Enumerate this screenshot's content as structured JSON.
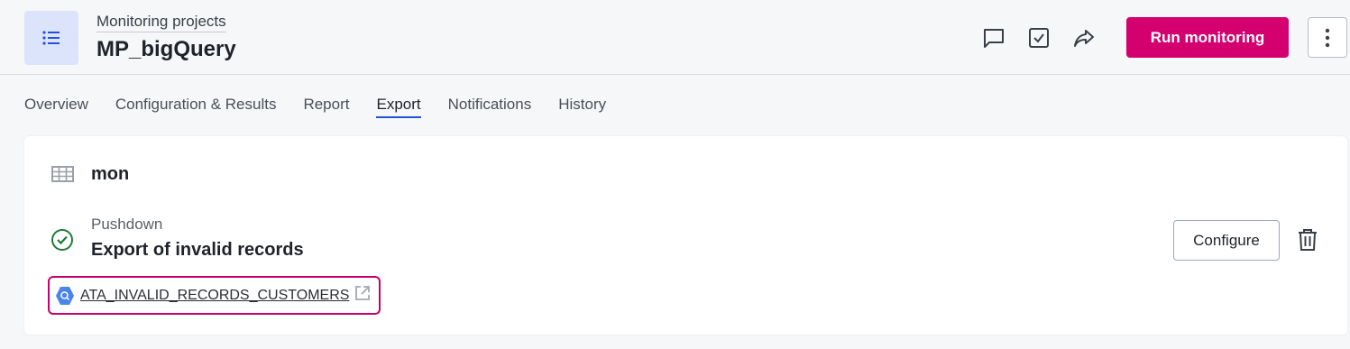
{
  "header": {
    "breadcrumb": "Monitoring projects",
    "title": "MP_bigQuery",
    "icons": [
      "list-icon",
      "comment-icon",
      "checkbox-icon",
      "share-icon",
      "more-vertical-icon"
    ],
    "run_label": "Run monitoring",
    "accent_color": "#d4006f"
  },
  "tabs": [
    {
      "label": "Overview",
      "active": false
    },
    {
      "label": "Configuration & Results",
      "active": false
    },
    {
      "label": "Report",
      "active": false
    },
    {
      "label": "Export",
      "active": true
    },
    {
      "label": "Notifications",
      "active": false
    },
    {
      "label": "History",
      "active": false
    }
  ],
  "card": {
    "icon": "table-icon",
    "title": "mon",
    "export": {
      "status_icon": "check-circle-icon",
      "subtype": "Pushdown",
      "title": "Export of invalid records",
      "link_icon": "bigquery-icon",
      "link_text": "ATA_INVALID_RECORDS_CUSTOMERS",
      "external_icon": "external-link-icon",
      "configure_label": "Configure",
      "delete_icon": "trash-icon"
    }
  }
}
